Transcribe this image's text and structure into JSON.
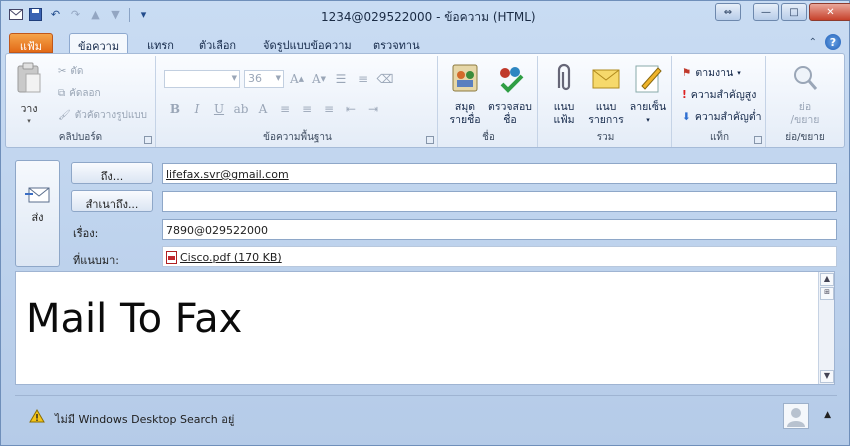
{
  "window": {
    "title": "1234@029522000 - ข้อความ (HTML)"
  },
  "tabs": [
    {
      "label": "แฟ้ม"
    },
    {
      "label": "ข้อความ"
    },
    {
      "label": "แทรก"
    },
    {
      "label": "ตัวเลือก"
    },
    {
      "label": "จัดรูปแบบข้อความ"
    },
    {
      "label": "ตรวจทาน"
    }
  ],
  "ribbon": {
    "clipboard": {
      "paste": "วาง",
      "cut": "ตัด",
      "copy": "คัดลอก",
      "format_painter": "ตัวคัดวางรูปแบบ",
      "label": "คลิปบอร์ด"
    },
    "basic_text": {
      "font_size": "36",
      "label": "ข้อความพื้นฐาน"
    },
    "names": {
      "address_book_1": "สมุด",
      "address_book_2": "รายชื่อ",
      "check_names_1": "ตรวจสอบ",
      "check_names_2": "ชื่อ",
      "label": "ชื่อ"
    },
    "include": {
      "attach_file_1": "แนบ",
      "attach_file_2": "แฟ้ม",
      "attach_item_1": "แนบ",
      "attach_item_2": "รายการ",
      "signature": "ลายเซ็น",
      "label": "รวม"
    },
    "tags": {
      "follow_up": "ตามงาน",
      "high_importance": "ความสำคัญสูง",
      "low_importance": "ความสำคัญต่ำ",
      "label": "แท็ก"
    },
    "zoom": {
      "zoom_1": "ย่อ",
      "zoom_2": "/ขยาย",
      "label": "ย่อ/ขยาย"
    }
  },
  "message": {
    "send": "ส่ง",
    "to_button": "ถึง...",
    "cc_button": "สำเนาถึง...",
    "subject_label": "เรื่อง:",
    "attached_label": "ที่แนบมา:",
    "to_value": "lifefax.svr@gmail.com",
    "cc_value": "",
    "subject_value": "7890@029522000",
    "attachment": "Cisco.pdf (170 KB)",
    "body": "Mail To Fax"
  },
  "status": {
    "text": "ไม่มี Windows Desktop Search อยู่"
  },
  "colors": {
    "file_tab": "#e36a17",
    "ribbon_bg": "#e4ecf7",
    "frame": "#bcd0ea"
  }
}
